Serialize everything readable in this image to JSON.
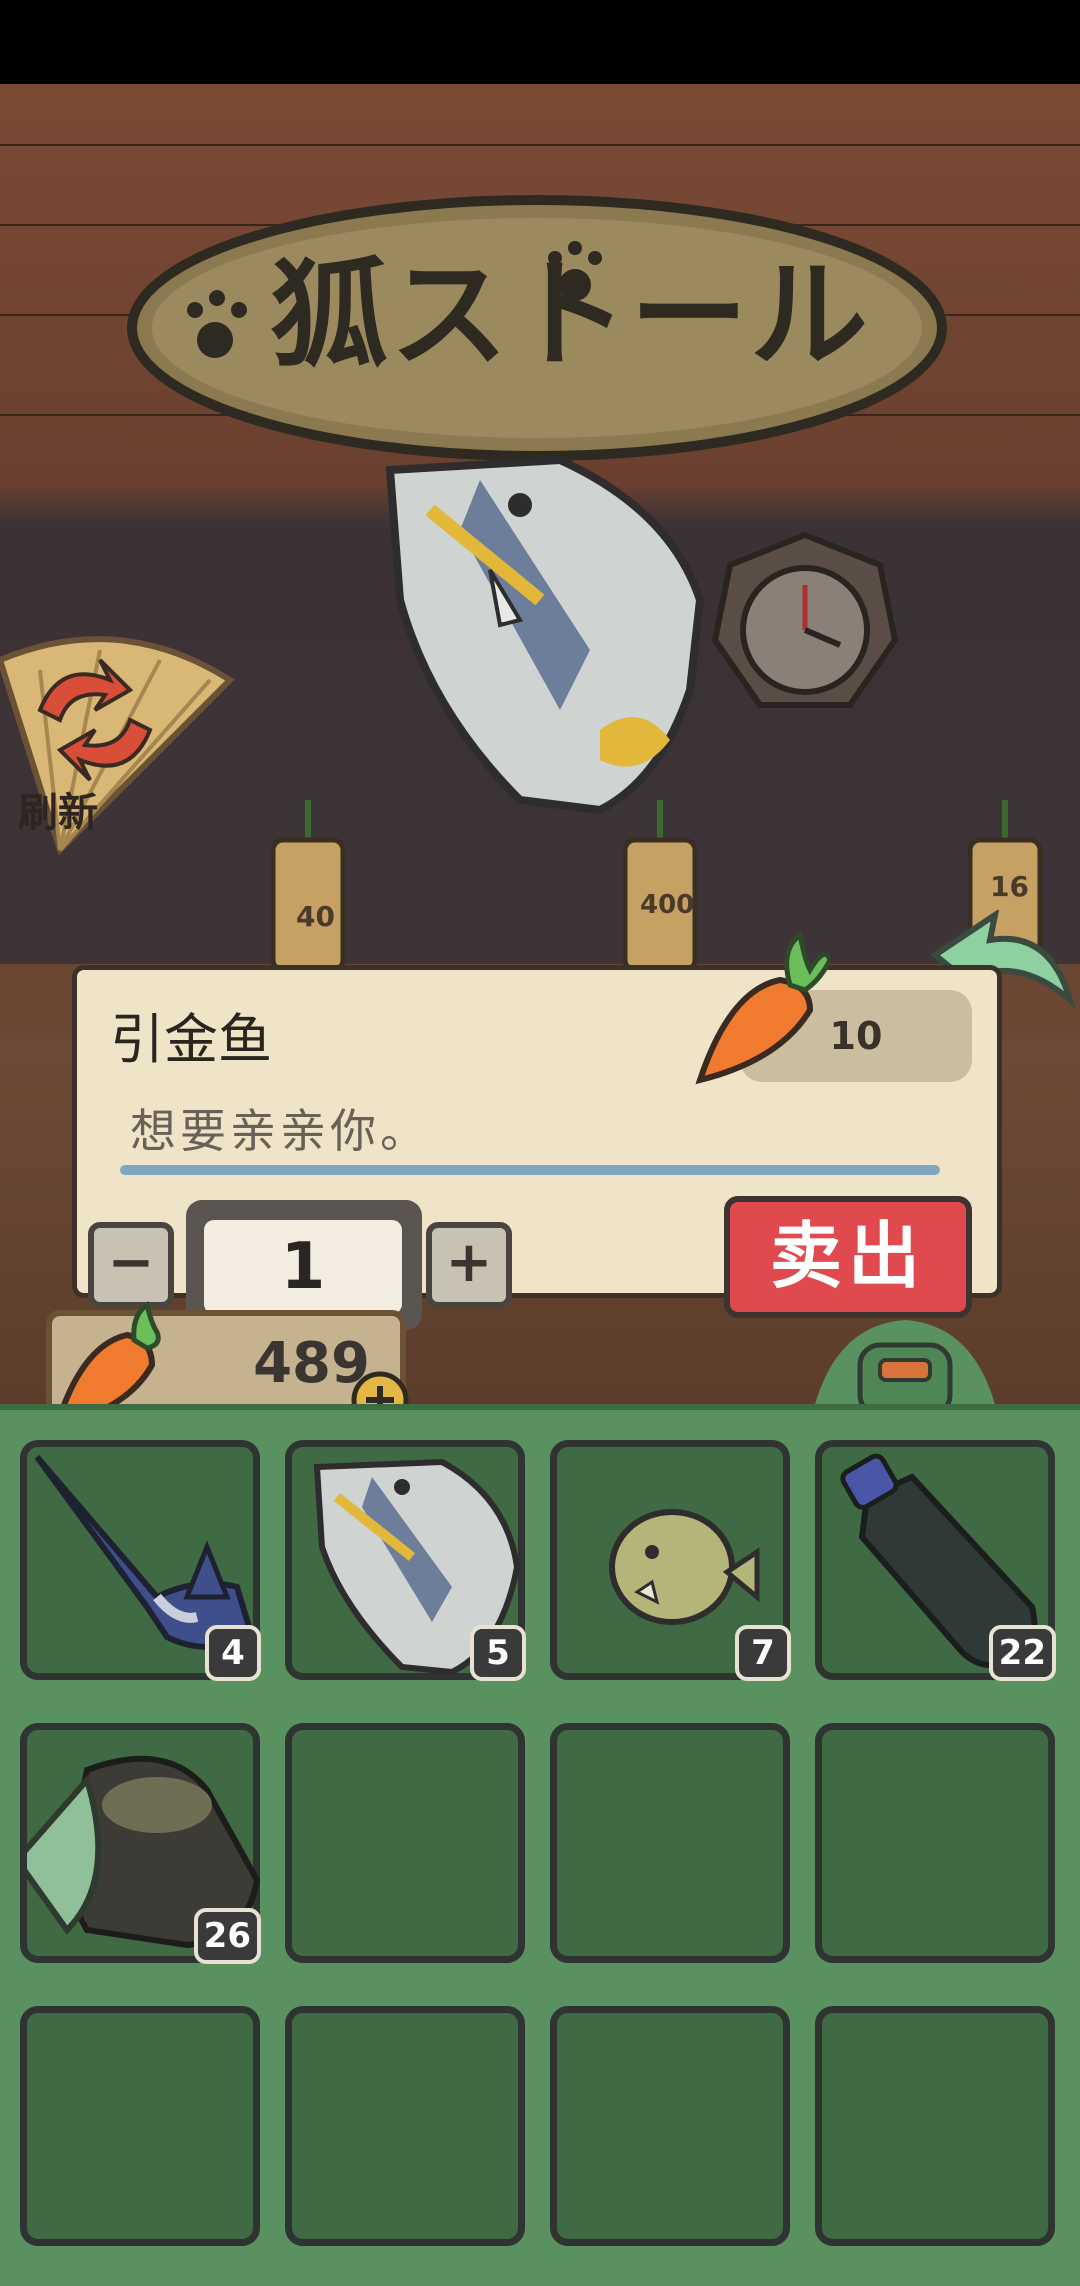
{
  "shop": {
    "sign_text": "狐ストール",
    "refresh_label": "刷新"
  },
  "hanging_tags": [
    "40",
    "400",
    "16"
  ],
  "item_panel": {
    "name": "引金鱼",
    "price": "10",
    "description": "想要亲亲你。",
    "quantity": "1",
    "minus_label": "−",
    "plus_label": "+",
    "sell_label": "卖出"
  },
  "wallet": {
    "carrots": "489"
  },
  "inventory": {
    "slots": [
      {
        "item": "swordfish",
        "count": "4"
      },
      {
        "item": "triggerfish",
        "count": "5"
      },
      {
        "item": "pufferfish",
        "count": "7"
      },
      {
        "item": "plastic-bottle",
        "count": "22"
      },
      {
        "item": "old-boot",
        "count": "26"
      },
      {
        "item": "",
        "count": ""
      },
      {
        "item": "",
        "count": ""
      },
      {
        "item": "",
        "count": ""
      },
      {
        "item": "",
        "count": ""
      },
      {
        "item": "",
        "count": ""
      },
      {
        "item": "",
        "count": ""
      },
      {
        "item": "",
        "count": ""
      }
    ]
  },
  "colors": {
    "sell_button": "#e0494d",
    "inventory_bg": "#5a9160",
    "slot_bg": "#3f6a44",
    "panel_bg": "#efe4c8"
  }
}
